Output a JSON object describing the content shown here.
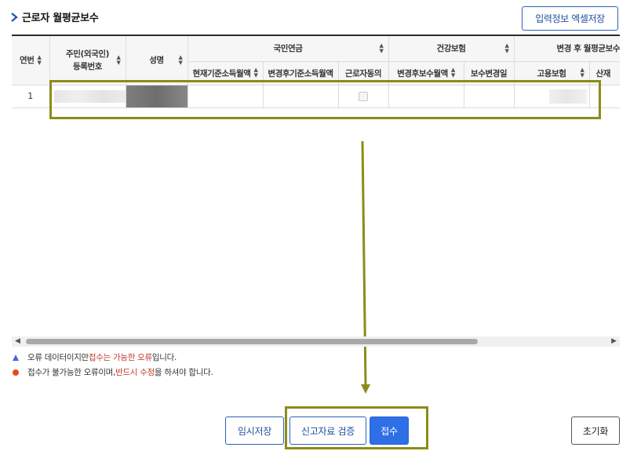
{
  "page": {
    "title": "근로자 월평균보수"
  },
  "toolbar": {
    "excel_label": "입력정보 엑셀저장"
  },
  "grid": {
    "headers": {
      "seq": "연번",
      "rrn_line1": "주민(외국인)",
      "rrn_line2": "등록번호",
      "name": "성명",
      "national_pension": "국민연금",
      "health_insurance": "건강보험",
      "after_change": "변경 후 월평균보수",
      "np_current": "현재기준소득월액",
      "np_changed": "변경후기준소득월액",
      "np_consent": "근로자동의",
      "hi_changed": "변경후보수월액",
      "hi_reason": "보수변경일",
      "ei": "고용보험",
      "ia": "산재"
    },
    "rows": [
      {
        "seq": "1"
      }
    ]
  },
  "legend": {
    "line1_a": "오류 데이터이지만 ",
    "line1_b": "접수는 가능한 오류",
    "line1_c": "입니다.",
    "line2_a": "접수가 불가능한 오류이며, ",
    "line2_b": "반드시 수정",
    "line2_c": "을 하셔야 합니다."
  },
  "buttons": {
    "temp_save": "임시저장",
    "verify": "신고자료 검증",
    "submit": "접수",
    "reset": "초기화"
  },
  "colors": {
    "accent": "#2e62b8",
    "submit_bg": "#2e6ee6",
    "highlight": "#8c8c1a",
    "warning_triangle": "#4a63e0",
    "error_dot": "#e84a1a",
    "error_text": "#c0392b"
  }
}
